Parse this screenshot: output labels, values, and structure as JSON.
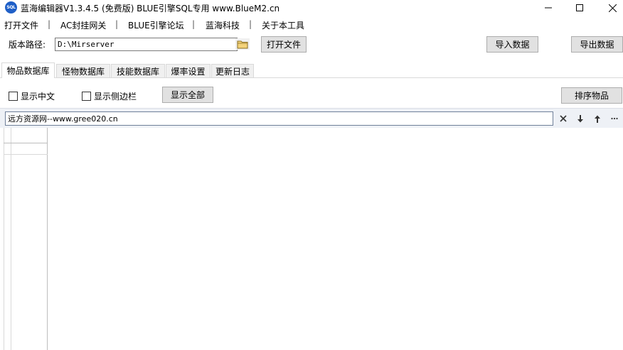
{
  "window": {
    "icon_text": "SQL",
    "title": "蓝海编辑器V1.3.4.5 (免费版)  BLUE引擎SQL专用   www.BlueM2.cn"
  },
  "menu": {
    "items": [
      "打开文件",
      "AC封挂网关",
      "BLUE引擎论坛",
      "蓝海科技",
      "关于本工具"
    ],
    "separator": "|"
  },
  "path": {
    "label": "版本路径:",
    "value": "D:\\Mirserver"
  },
  "buttons": {
    "open_file": "打开文件",
    "import_data": "导入数据",
    "export_data": "导出数据",
    "show_all": "显示全部",
    "sort_items": "排序物品"
  },
  "tabs": [
    {
      "label": "物品数据库",
      "active": true
    },
    {
      "label": "怪物数据库",
      "active": false
    },
    {
      "label": "技能数据库",
      "active": false
    },
    {
      "label": "爆率设置",
      "active": false
    },
    {
      "label": "更新日志",
      "active": false
    }
  ],
  "options": {
    "show_chinese": {
      "label": "显示中文",
      "checked": false
    },
    "show_sidebar": {
      "label": "显示侧边栏",
      "checked": false
    }
  },
  "filter": {
    "value": "远方资源网--www.gree020.cn"
  },
  "icons": {
    "clear": "close-icon",
    "next": "arrow-down-icon",
    "prev": "arrow-up-icon",
    "more": "more-icon"
  },
  "colors": {
    "filter_bar_bg": "#eef1f6",
    "app_icon_bg": "#1f5fc7"
  }
}
